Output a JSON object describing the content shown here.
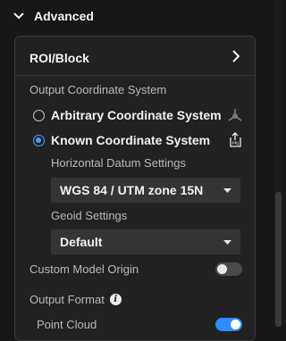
{
  "section": {
    "title": "Advanced"
  },
  "roi": {
    "label": "ROI/Block"
  },
  "output_coord": {
    "label": "Output Coordinate System",
    "options": [
      {
        "label": "Arbitrary Coordinate System",
        "selected": false
      },
      {
        "label": "Known Coordinate System",
        "selected": true
      }
    ],
    "prj_icon_text": "PRJ"
  },
  "horizontal_datum": {
    "label": "Horizontal Datum Settings",
    "value": "WGS 84 / UTM zone 15N"
  },
  "geoid": {
    "label": "Geoid Settings",
    "value": "Default"
  },
  "custom_model_origin": {
    "label": "Custom Model Origin",
    "enabled": false
  },
  "output_format": {
    "label": "Output Format",
    "info_icon": "i",
    "point_cloud": {
      "label": "Point Cloud",
      "enabled": true
    }
  },
  "colors": {
    "accent": "#4aa3ff",
    "toggle_on": "#2f8cff",
    "panel_bg": "#212121"
  }
}
